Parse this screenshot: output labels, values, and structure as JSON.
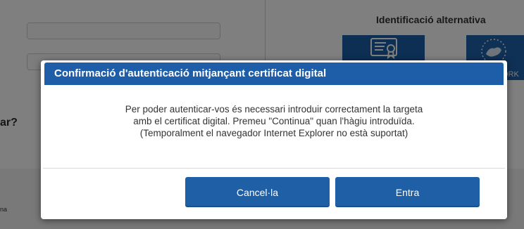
{
  "background": {
    "alternative_title": "Identificació alternativa",
    "partial_question": "ar?",
    "partial_footer_text": "na",
    "tile_partial_caption": "ORK"
  },
  "modal": {
    "title": "Confirmació d'autenticació mitjançant certificat digital",
    "body_lines": [
      "Per poder autenticar-vos és necessari introduir correctament la targeta",
      "amb el certificat digital. Premeu \"Continua\" quan l'hàgiu introduïda.",
      "(Temporalment el navegador Internet Explorer no està suportat)"
    ],
    "cancel_label": "Cancel·la",
    "enter_label": "Entra"
  },
  "colors": {
    "header_blue": "#1e5ea8",
    "button_blue": "#1f5fa6",
    "overlay": "rgba(0,0,0,0.5)"
  },
  "icons": {
    "certificate_tile": "certificate-card-icon",
    "other_tile": "europe-map-icon"
  }
}
